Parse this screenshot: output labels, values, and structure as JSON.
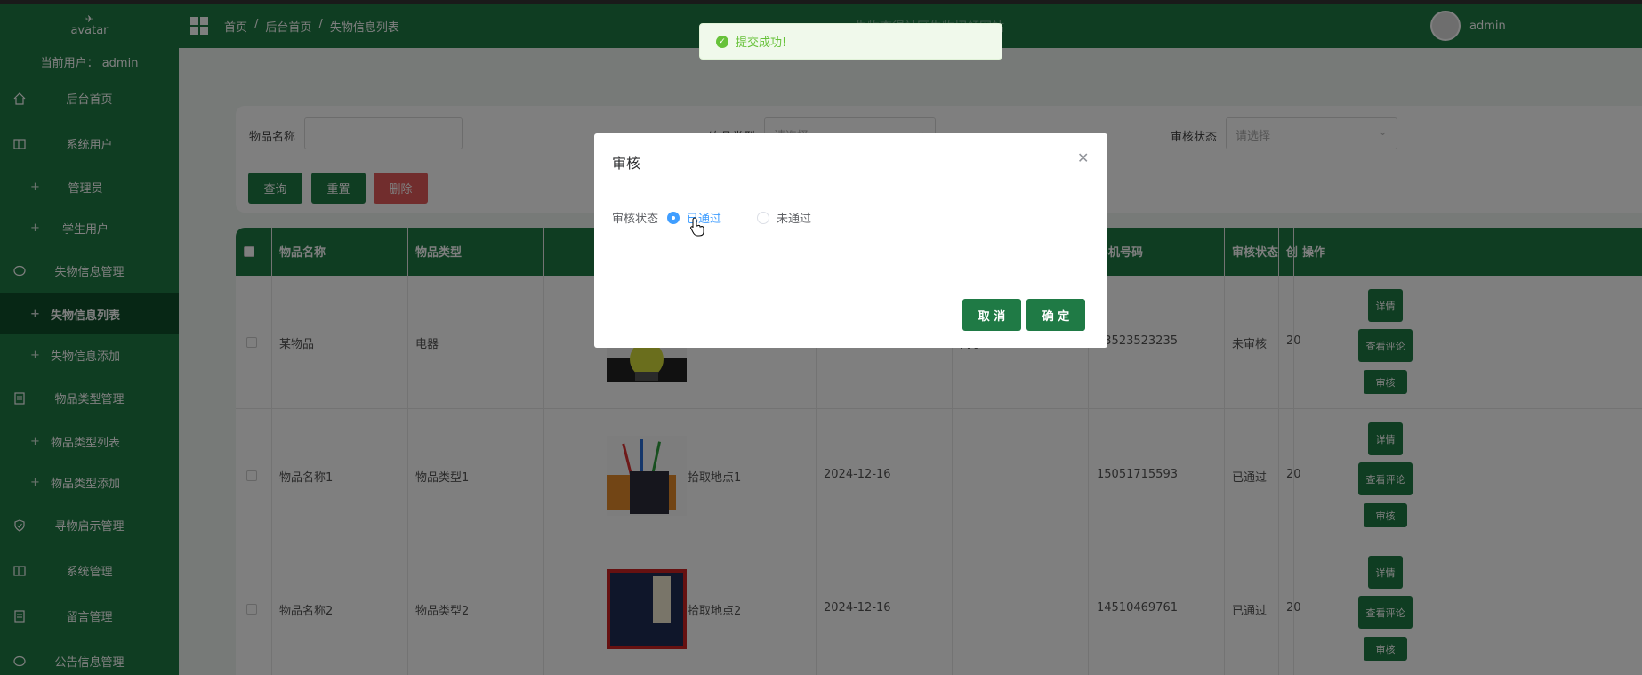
{
  "sidebar": {
    "avatar_alt": "avatar",
    "current_user": "当前用户：  admin",
    "menu": [
      {
        "label": "后台首页",
        "icon": "home-icon",
        "type": "menu"
      },
      {
        "label": "系统用户",
        "icon": "columns-icon",
        "type": "menu"
      },
      {
        "label": "管理员",
        "type": "sub"
      },
      {
        "label": "学生用户",
        "type": "sub"
      },
      {
        "label": "失物信息管理",
        "icon": "chat-bubble-icon",
        "type": "menu"
      },
      {
        "label": "失物信息列表",
        "type": "sub",
        "active": true
      },
      {
        "label": "失物信息添加",
        "type": "sub"
      },
      {
        "label": "物品类型管理",
        "icon": "document-icon",
        "type": "menu"
      },
      {
        "label": "物品类型列表",
        "type": "sub"
      },
      {
        "label": "物品类型添加",
        "type": "sub"
      },
      {
        "label": "寻物启示管理",
        "icon": "shield-check-icon",
        "type": "menu"
      },
      {
        "label": "系统管理",
        "icon": "columns-icon",
        "type": "menu"
      },
      {
        "label": "留言管理",
        "icon": "document-icon",
        "type": "menu"
      },
      {
        "label": "公告信息管理",
        "icon": "chat-bubble-icon",
        "type": "menu"
      }
    ]
  },
  "header": {
    "breadcrumb": [
      "首页",
      "/",
      "后台首页",
      "/",
      "失物信息列表"
    ],
    "site_title": "失物查得社区失物招领网站",
    "user": "admin"
  },
  "filter": {
    "name_label": "物品名称",
    "name_value": "",
    "type_label": "物品类型",
    "type_placeholder": "请选择",
    "status_label": "审核状态",
    "status_placeholder": "请选择",
    "query": "查询",
    "reset": "重置",
    "delete": "删除"
  },
  "table": {
    "headers": [
      "物品名称",
      "物品类型",
      "",
      "",
      "",
      "人",
      "手机号码",
      "审核状态",
      "创",
      "操作"
    ],
    "rows": [
      {
        "name": "某物品",
        "type": "电器",
        "place": "",
        "date": "",
        "person": "同学-11111",
        "phone": "13523523235",
        "status": "未审核",
        "created": "20"
      },
      {
        "name": "物品名称1",
        "type": "物品类型1",
        "place": "拾取地点1",
        "date": "2024-12-16",
        "person": "",
        "phone": "15051715593",
        "status": "已通过",
        "created": "20"
      },
      {
        "name": "物品名称2",
        "type": "物品类型2",
        "place": "拾取地点2",
        "date": "2024-12-16",
        "person": "",
        "phone": "14510469761",
        "status": "已通过",
        "created": "20"
      }
    ],
    "op_detail": "详情",
    "op_comments": "查看评论",
    "op_review": "审核"
  },
  "toast": {
    "message": "提交成功!"
  },
  "dialog": {
    "title": "审核",
    "field_label": "审核状态",
    "options": [
      "已通过",
      "未通过"
    ],
    "selected": "已通过",
    "cancel": "取 消",
    "confirm": "确 定"
  },
  "colors": {
    "primary": "#1f7a45",
    "accent": "#409eff",
    "danger": "#e35a5a"
  }
}
